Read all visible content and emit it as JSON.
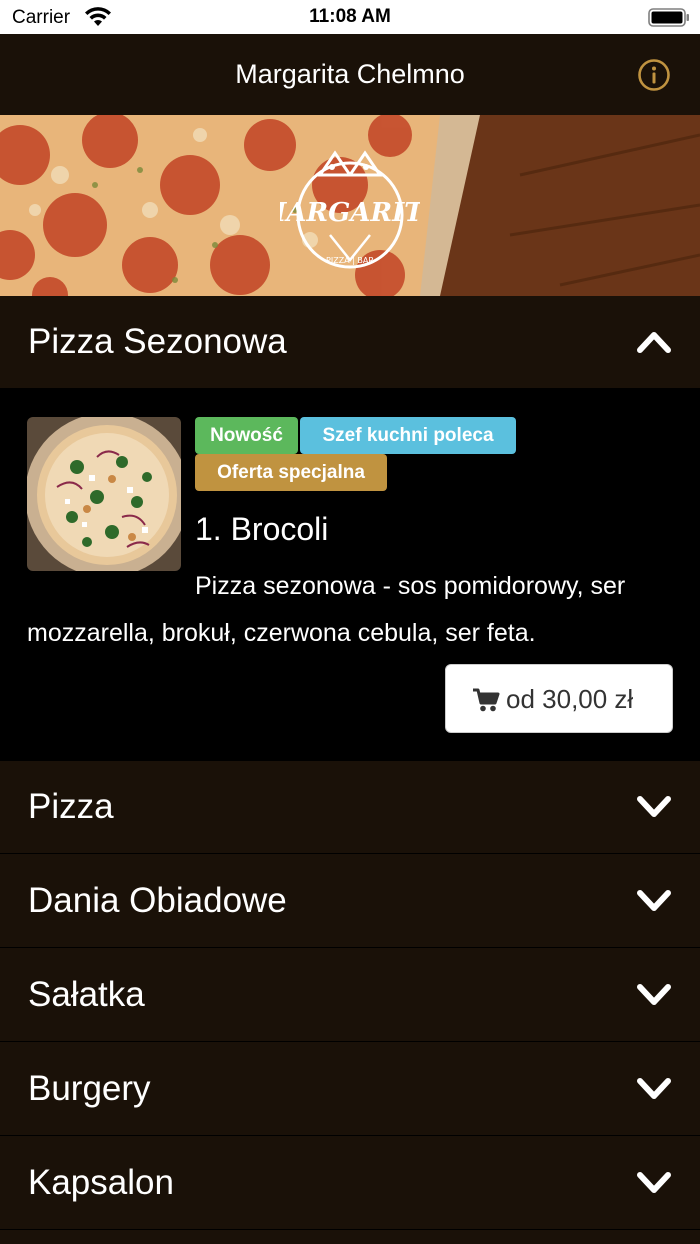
{
  "status_bar": {
    "carrier": "Carrier",
    "time": "11:08 AM"
  },
  "nav": {
    "title": "Margarita Chelmno"
  },
  "hero": {
    "logo_text": "MARGARITA",
    "logo_sub": "PIZZA | BAR"
  },
  "sections": {
    "expanded": {
      "label": "Pizza Sezonowa"
    },
    "s1": {
      "label": "Pizza"
    },
    "s2": {
      "label": "Dania Obiadowe"
    },
    "s3": {
      "label": "Sałatka"
    },
    "s4": {
      "label": "Burgery"
    },
    "s5": {
      "label": "Kapsalon"
    }
  },
  "item": {
    "badges": {
      "new": "Nowość",
      "chef": "Szef kuchni poleca",
      "special": "Oferta specjalna"
    },
    "title": "1. Brocoli",
    "description": "Pizza sezonowa - sos pomidorowy, ser mozzarella, brokuł, czerwona cebula, ser feta.",
    "price": "od 30,00 zł"
  },
  "colors": {
    "background": "#1a1108",
    "accent_gold": "#c09340",
    "badge_green": "#5cb85c",
    "badge_blue": "#5bc0de"
  },
  "icons": {
    "info": "info-circle-icon",
    "collapse": "chevron-up-icon",
    "expand": "chevron-down-icon",
    "cart": "shopping-cart-icon"
  }
}
